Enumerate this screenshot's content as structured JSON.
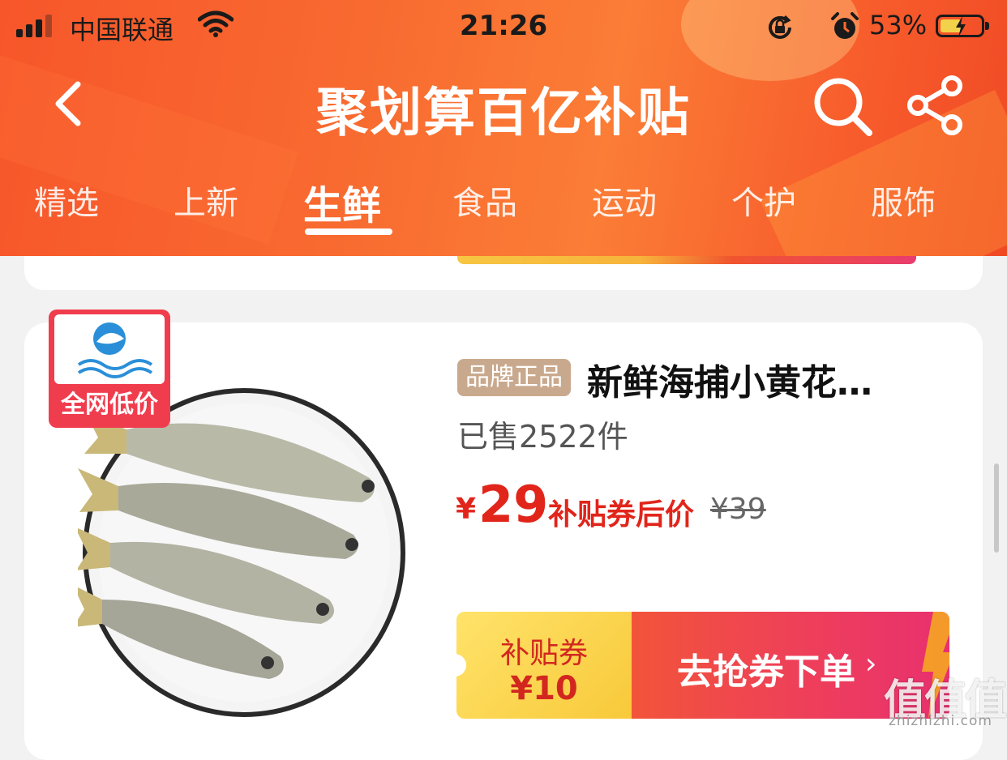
{
  "status_bar": {
    "carrier": "中国联通",
    "time": "21:26",
    "battery_percent": "53%",
    "battery_level": 0.53
  },
  "nav": {
    "title": "聚划算百亿补贴"
  },
  "tabs": [
    {
      "label": "精选",
      "active": false
    },
    {
      "label": "上新",
      "active": false
    },
    {
      "label": "生鲜",
      "active": true
    },
    {
      "label": "食品",
      "active": false
    },
    {
      "label": "运动",
      "active": false
    },
    {
      "label": "个护",
      "active": false
    },
    {
      "label": "服饰",
      "active": false
    }
  ],
  "product": {
    "badge_label": "全网低价",
    "brand_tag": "品牌正品",
    "title": "新鲜海捕小黄花…",
    "sold": "已售2522件",
    "currency": "¥",
    "price": "29",
    "price_label": "补贴券后价",
    "original_price": "¥39",
    "coupon_label": "补贴券",
    "coupon_value": "¥10",
    "cta_label": "去抢券下单",
    "cta_chevron": "›"
  },
  "watermark": {
    "brand": "值值值",
    "domain": "zhizhizhi.com"
  },
  "icons": {
    "back": "chevron-left",
    "search": "magnifier",
    "share": "share-nodes"
  },
  "colors": {
    "header_orange": "#f86a30",
    "price_red": "#e1251b",
    "coupon_yellow": "#f8c93a",
    "cta_pink": "#ee3f5a"
  }
}
